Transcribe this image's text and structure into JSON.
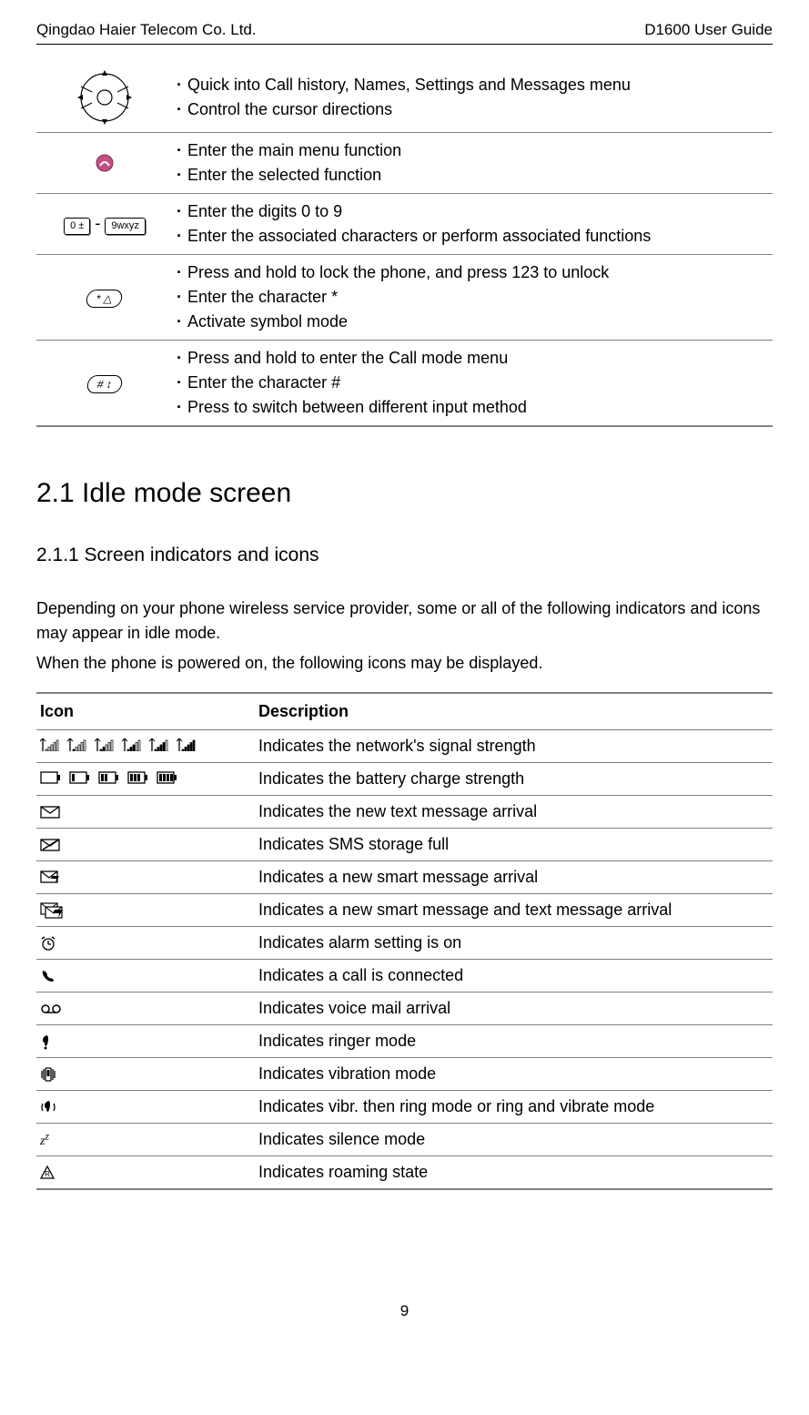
{
  "header": {
    "company": "Qingdao Haier Telecom Co. Ltd.",
    "guide": "D1600 User Guide"
  },
  "keys_table": [
    {
      "icon": "dpad-icon",
      "bullets": [
        "Quick into Call history, Names, Settings and Messages menu",
        "Control the cursor directions"
      ]
    },
    {
      "icon": "ok-key-icon",
      "bullets": [
        "Enter the main menu function",
        "Enter the selected function"
      ]
    },
    {
      "icon": "numkeys-icon",
      "num_left": "0 ±",
      "num_sep": "-",
      "num_right": "9wxyz",
      "bullets": [
        "Enter the digits 0 to 9",
        "Enter the associated characters or perform associated functions"
      ]
    },
    {
      "icon": "star-key-icon",
      "key_label": "* △",
      "bullets": [
        "Press and hold to lock the phone, and press 123 to unlock",
        "Enter the character *",
        "Activate symbol mode"
      ]
    },
    {
      "icon": "hash-key-icon",
      "key_label": "# ↕",
      "bullets": [
        "Press and hold to enter the Call mode menu",
        "Enter the character #",
        "Press to switch between different input method"
      ]
    }
  ],
  "section_2_1_title": "2.1 Idle mode screen",
  "section_2_1_1_title": "2.1.1 Screen indicators and icons",
  "intro_para_1": "Depending on your phone wireless service provider, some or all of the following indicators and icons may appear in idle mode.",
  "intro_para_2": "When the phone is powered on, the following icons may be displayed.",
  "icons_table": {
    "headers": {
      "icon": "Icon",
      "desc": "Description"
    },
    "rows": [
      {
        "icon": "signal-strength-icon",
        "desc": "Indicates the network's signal strength"
      },
      {
        "icon": "battery-strength-icon",
        "desc": "Indicates the battery charge strength"
      },
      {
        "icon": "new-sms-icon",
        "desc": "Indicates the new text message arrival"
      },
      {
        "icon": "sms-full-icon",
        "desc": "Indicates SMS storage full"
      },
      {
        "icon": "smart-msg-icon",
        "desc": "Indicates a new smart message arrival"
      },
      {
        "icon": "smart-and-text-icon",
        "desc": "Indicates a new smart message and text message arrival"
      },
      {
        "icon": "alarm-on-icon",
        "desc": "Indicates alarm setting is on"
      },
      {
        "icon": "call-connected-icon",
        "desc": "Indicates a call is connected"
      },
      {
        "icon": "voicemail-icon",
        "desc": "Indicates voice mail arrival"
      },
      {
        "icon": "ringer-mode-icon",
        "desc": "Indicates ringer mode"
      },
      {
        "icon": "vibration-mode-icon",
        "desc": "Indicates vibration mode"
      },
      {
        "icon": "vibr-ring-mode-icon",
        "desc": "Indicates vibr. then ring mode or ring and vibrate mode"
      },
      {
        "icon": "silence-mode-icon",
        "desc": "Indicates silence mode"
      },
      {
        "icon": "roaming-icon",
        "desc": "Indicates roaming state"
      }
    ]
  },
  "page_number": "9"
}
